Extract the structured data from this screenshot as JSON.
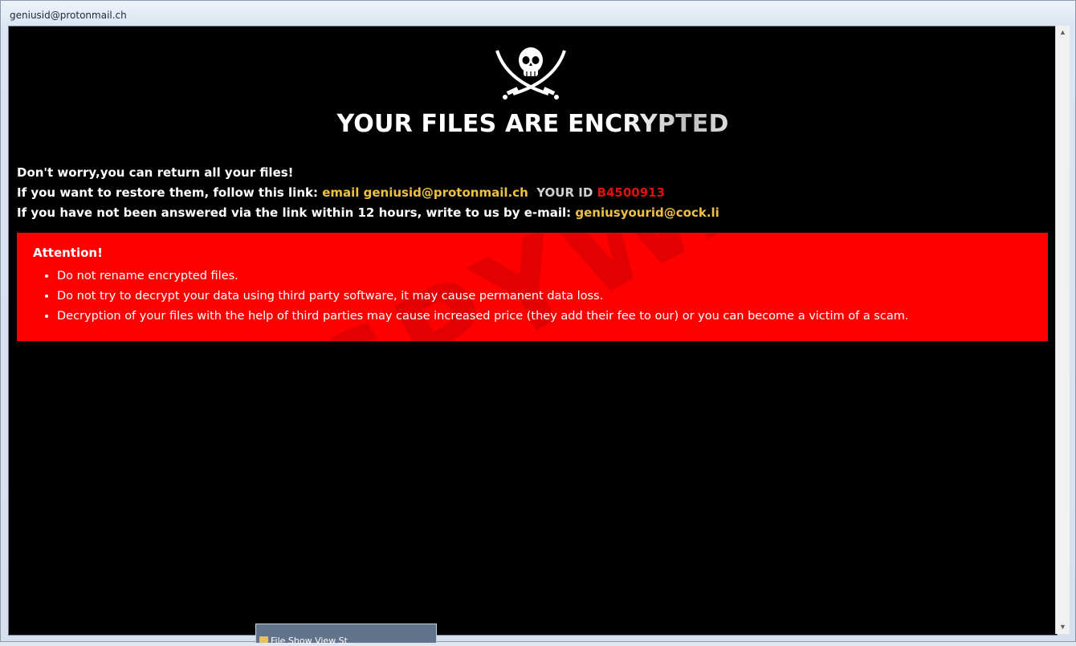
{
  "window": {
    "title": "geniusid@protonmail.ch"
  },
  "note": {
    "logo_icon": "jolly-roger-skull-crossed-swords-icon",
    "headline_main": "YOUR FILES ARE ENC",
    "headline_fade": "RYPTED",
    "line1": "Don't worry,you can return all your files!",
    "line2_prefix": "If you want to restore them, follow this link: ",
    "line2_email": "email geniusid@protonmail.ch",
    "line2_id_label": "YOUR ID",
    "line2_id_value": "B4500913",
    "line3_prefix": "If you have not been answered via the link within 12 hours, write to us by e-mail: ",
    "line3_email": "geniusyourid@cock.li",
    "colors": {
      "background": "#000000",
      "attention_bg": "#ff0000",
      "email": "#f0c040",
      "id": "#e01010"
    }
  },
  "attention": {
    "title": "Attention!",
    "items": [
      "Do not rename encrypted files.",
      "Do not try to decrypt your data using third party software, it may cause permanent data loss.",
      "Decryption of your files with the help of third parties may cause increased price (they add their fee to our) or you can become a victim of a scam."
    ]
  },
  "taskbar_popup": {
    "text": "File  Show  View  St"
  }
}
